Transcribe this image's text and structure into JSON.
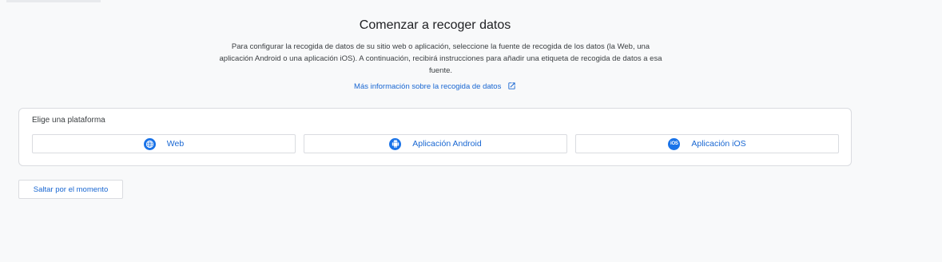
{
  "header": {
    "title": "Comenzar a recoger datos",
    "description": "Para configurar la recogida de datos de su sitio web o aplicación, seleccione la fuente de recogida de los datos (la Web, una aplicación Android o una aplicación iOS). A continuación, recibirá instrucciones para añadir una etiqueta de recogida de datos a esa fuente.",
    "more_link": "Más información sobre la recogida de datos",
    "more_link_icon": "open-in-new-icon"
  },
  "platform_card": {
    "label": "Elige una plataforma",
    "buttons": [
      {
        "label": "Web",
        "icon": "globe-icon"
      },
      {
        "label": "Aplicación Android",
        "icon": "android-icon"
      },
      {
        "label": "Aplicación iOS",
        "icon": "ios-icon",
        "icon_text": "iOS"
      }
    ]
  },
  "skip_button": {
    "label": "Saltar por el momento"
  },
  "colors": {
    "accent": "#1a73e8",
    "link": "#1967d2",
    "border": "#dadce0",
    "background": "#f8f9fa"
  }
}
